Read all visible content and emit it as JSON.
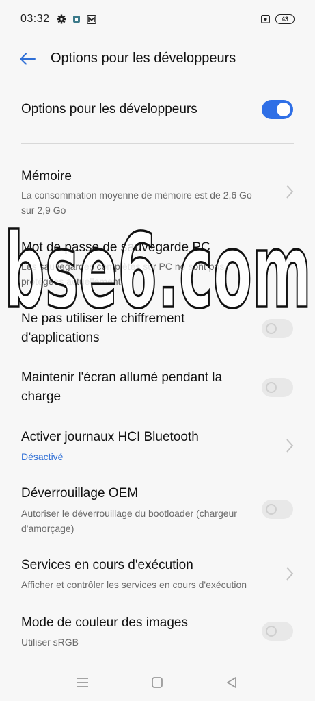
{
  "status_bar": {
    "time": "03:32",
    "battery_level": "43",
    "icons": [
      "gear-icon",
      "app-notification-icon",
      "mail-icon",
      "screenshot-icon",
      "battery-icon"
    ]
  },
  "header": {
    "back_icon": "back-arrow-icon",
    "title": "Options pour les développeurs"
  },
  "master_toggle": {
    "label": "Options pour les développeurs",
    "state": "on",
    "accent_color": "#2f6fe6"
  },
  "settings": [
    {
      "title": "Mémoire",
      "subtitle": "La consommation moyenne de mémoire est de 2,6 Go sur 2,9 Go",
      "control": "chevron"
    },
    {
      "title": "Mot de passe de sauvegarde PC",
      "subtitle": "Les sauvegardes complètes sur PC ne sont pas protégées actuellement",
      "control": "chevron"
    },
    {
      "title": "Ne pas utiliser le chiffrement d'applications",
      "control": "toggle",
      "state": "off"
    },
    {
      "title": "Maintenir l'écran allumé pendant la charge",
      "control": "toggle",
      "state": "off"
    },
    {
      "title": "Activer journaux HCI Bluetooth",
      "subtitle": "Désactivé",
      "control": "chevron"
    },
    {
      "title": "Déverrouillage OEM",
      "subtitle": "Autoriser le déverrouillage du bootloader (chargeur d'amorçage)",
      "control": "toggle",
      "state": "off"
    },
    {
      "title": "Services en cours d'exécution",
      "subtitle": "Afficher et contrôler les services en cours d'exécution",
      "control": "chevron"
    },
    {
      "title": "Mode de couleur des images",
      "subtitle": "Utiliser sRGB",
      "control": "toggle",
      "state": "off"
    }
  ],
  "watermark": {
    "text": "bse6.com"
  },
  "nav_bar": {
    "icons": [
      "menu-icon",
      "home-icon",
      "back-triangle-icon"
    ]
  }
}
